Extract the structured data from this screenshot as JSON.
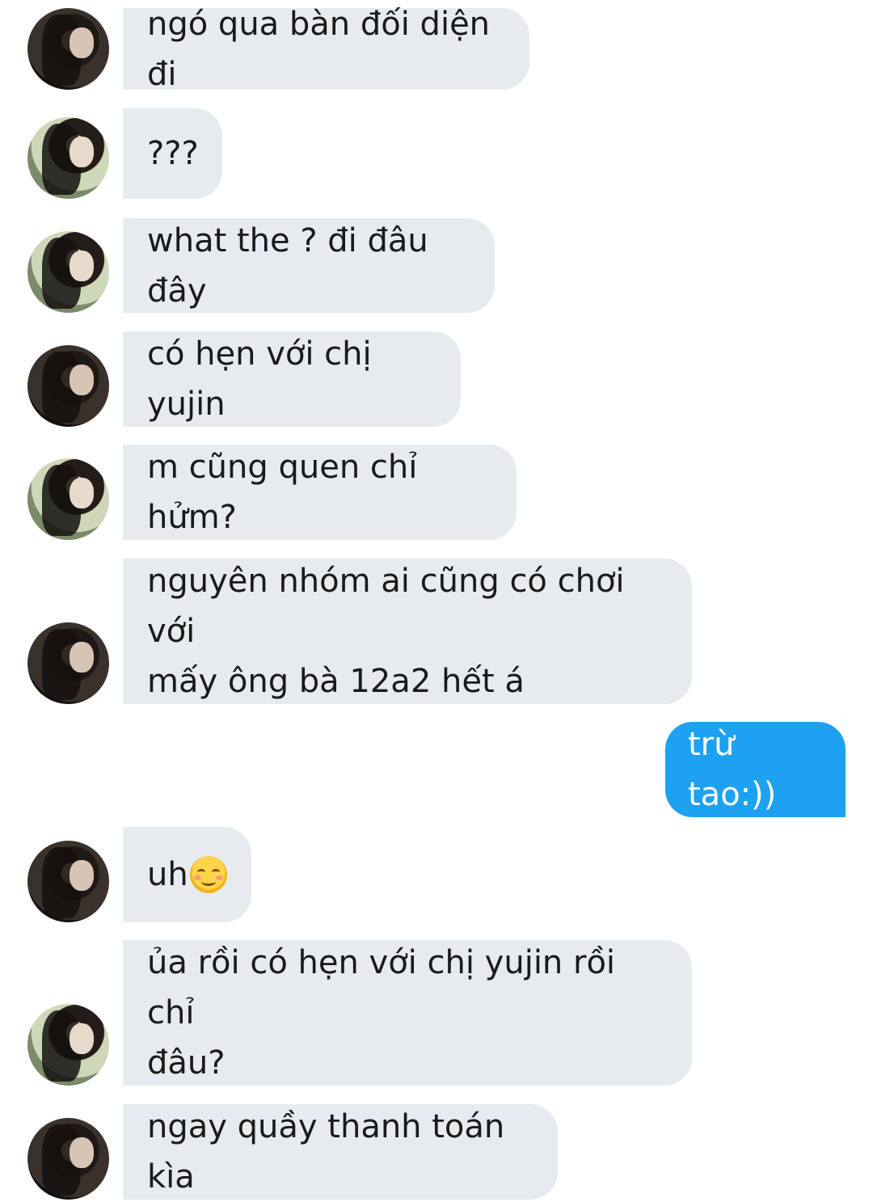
{
  "messages": [
    {
      "sender": "other",
      "avatar": "avatar-a",
      "text": "ngó qua bàn đối diện đi"
    },
    {
      "sender": "other",
      "avatar": "avatar-b",
      "text": "???"
    },
    {
      "sender": "other",
      "avatar": "avatar-b",
      "text": "what the ? đi đâu đây"
    },
    {
      "sender": "other",
      "avatar": "avatar-a",
      "text": "có hẹn với chị yujin"
    },
    {
      "sender": "other",
      "avatar": "avatar-b",
      "text": "m cũng quen chỉ hửm?"
    },
    {
      "sender": "other",
      "avatar": "avatar-a",
      "text": "nguyên nhóm ai cũng có chơi với\nmấy ông bà 12a2 hết á"
    },
    {
      "sender": "self",
      "text": "trừ tao:))"
    },
    {
      "sender": "other",
      "avatar": "avatar-a",
      "text": "uh",
      "emoji": "smiling-face-with-smiling-eyes"
    },
    {
      "sender": "other",
      "avatar": "avatar-b",
      "text": "ủa rồi có hẹn với chị yujin rồi chỉ\nđâu?"
    },
    {
      "sender": "other",
      "avatar": "avatar-a",
      "text": "ngay quầy thanh toán kìa"
    }
  ],
  "colors": {
    "incoming_bubble": "#e6ebf0",
    "outgoing_bubble": "#1da1f2",
    "outgoing_text": "#ffffff"
  }
}
